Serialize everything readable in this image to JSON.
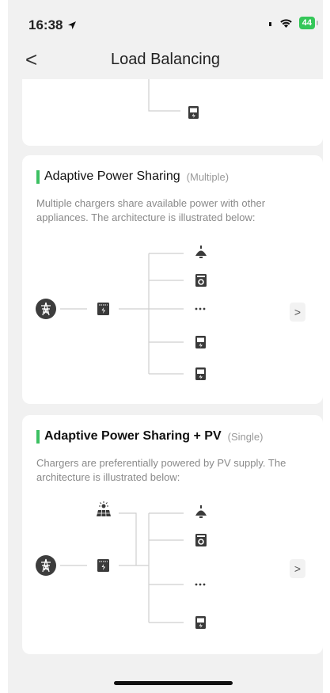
{
  "status": {
    "time": "16:38",
    "battery": "44"
  },
  "nav": {
    "title": "Load Balancing",
    "back_glyph": "<"
  },
  "cards": [
    {
      "title": "Adaptive Power Sharing",
      "tag": "(Multiple)",
      "description": "Multiple chargers share available power with other appliances. The architecture is illustrated below:",
      "ellipsis": "...",
      "next_glyph": ">"
    },
    {
      "title": "Adaptive Power Sharing + PV",
      "tag": "(Single)",
      "description": "Chargers are preferentially powered by PV supply. The architecture is illustrated below:",
      "ellipsis": "...",
      "next_glyph": ">"
    }
  ],
  "icons": [
    "location-arrow-icon",
    "signal-icon",
    "wifi-icon",
    "battery-icon",
    "back-icon",
    "grid-tower-icon",
    "meter-icon",
    "lamp-icon",
    "washer-icon",
    "charger-icon",
    "solar-panel-icon",
    "chevron-right-icon"
  ]
}
